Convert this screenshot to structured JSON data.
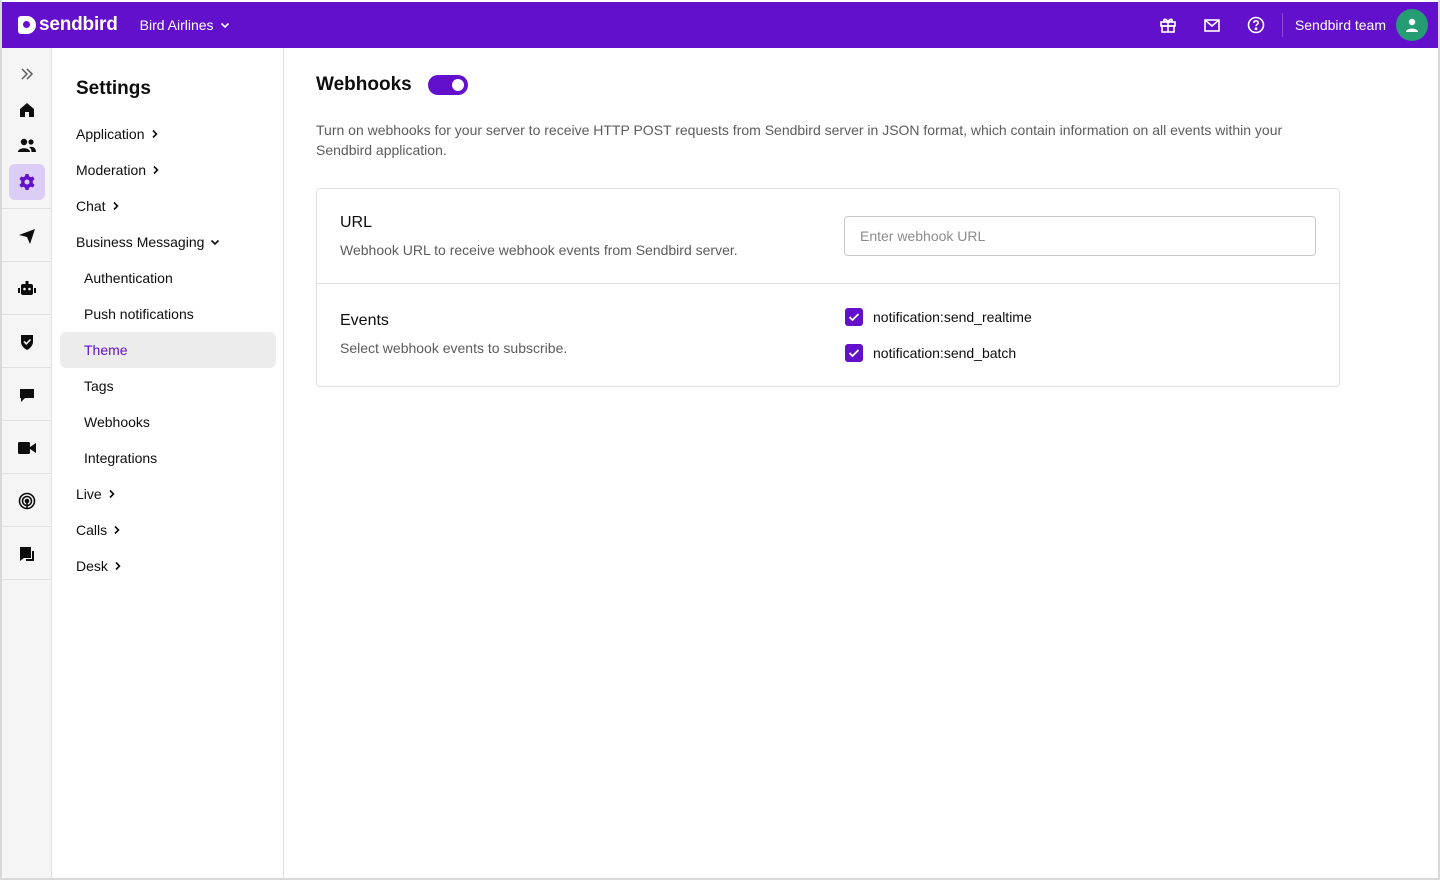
{
  "topbar": {
    "logo_text": "sendbird",
    "app_name": "Bird Airlines",
    "icons": [
      "gift-icon",
      "mail-icon",
      "help-icon"
    ],
    "user_name": "Sendbird team",
    "brand_color": "#6210cc",
    "avatar_color": "#259c72"
  },
  "rail": {
    "items": [
      "expand-icon",
      "home-icon",
      "users-icon",
      "settings-icon",
      "send-icon",
      "bot-icon",
      "shield-icon",
      "chat-icon",
      "video-icon",
      "live-icon",
      "desk-icon"
    ],
    "active": "settings-icon"
  },
  "settings_nav": {
    "title": "Settings",
    "sections": [
      {
        "label": "Application",
        "expanded": false
      },
      {
        "label": "Moderation",
        "expanded": false
      },
      {
        "label": "Chat",
        "expanded": false
      },
      {
        "label": "Business Messaging",
        "expanded": true,
        "children": [
          "Authentication",
          "Push notifications",
          "Theme",
          "Tags",
          "Webhooks",
          "Integrations"
        ],
        "active_child": "Theme"
      },
      {
        "label": "Live",
        "expanded": false
      },
      {
        "label": "Calls",
        "expanded": false
      },
      {
        "label": "Desk",
        "expanded": false
      }
    ]
  },
  "main": {
    "title": "Webhooks",
    "toggle_on": true,
    "description": "Turn on webhooks for your server to receive HTTP POST requests from Sendbird server in JSON format, which contain information on all events within your Sendbird application.",
    "url_section": {
      "label": "URL",
      "sublabel": "Webhook URL to receive webhook events from Sendbird server.",
      "input_value": "",
      "input_placeholder": "Enter webhook URL"
    },
    "events_section": {
      "label": "Events",
      "sublabel": "Select webhook events to subscribe.",
      "events": [
        {
          "label": "notification:send_realtime",
          "checked": true
        },
        {
          "label": "notification:send_batch",
          "checked": true
        }
      ]
    }
  }
}
